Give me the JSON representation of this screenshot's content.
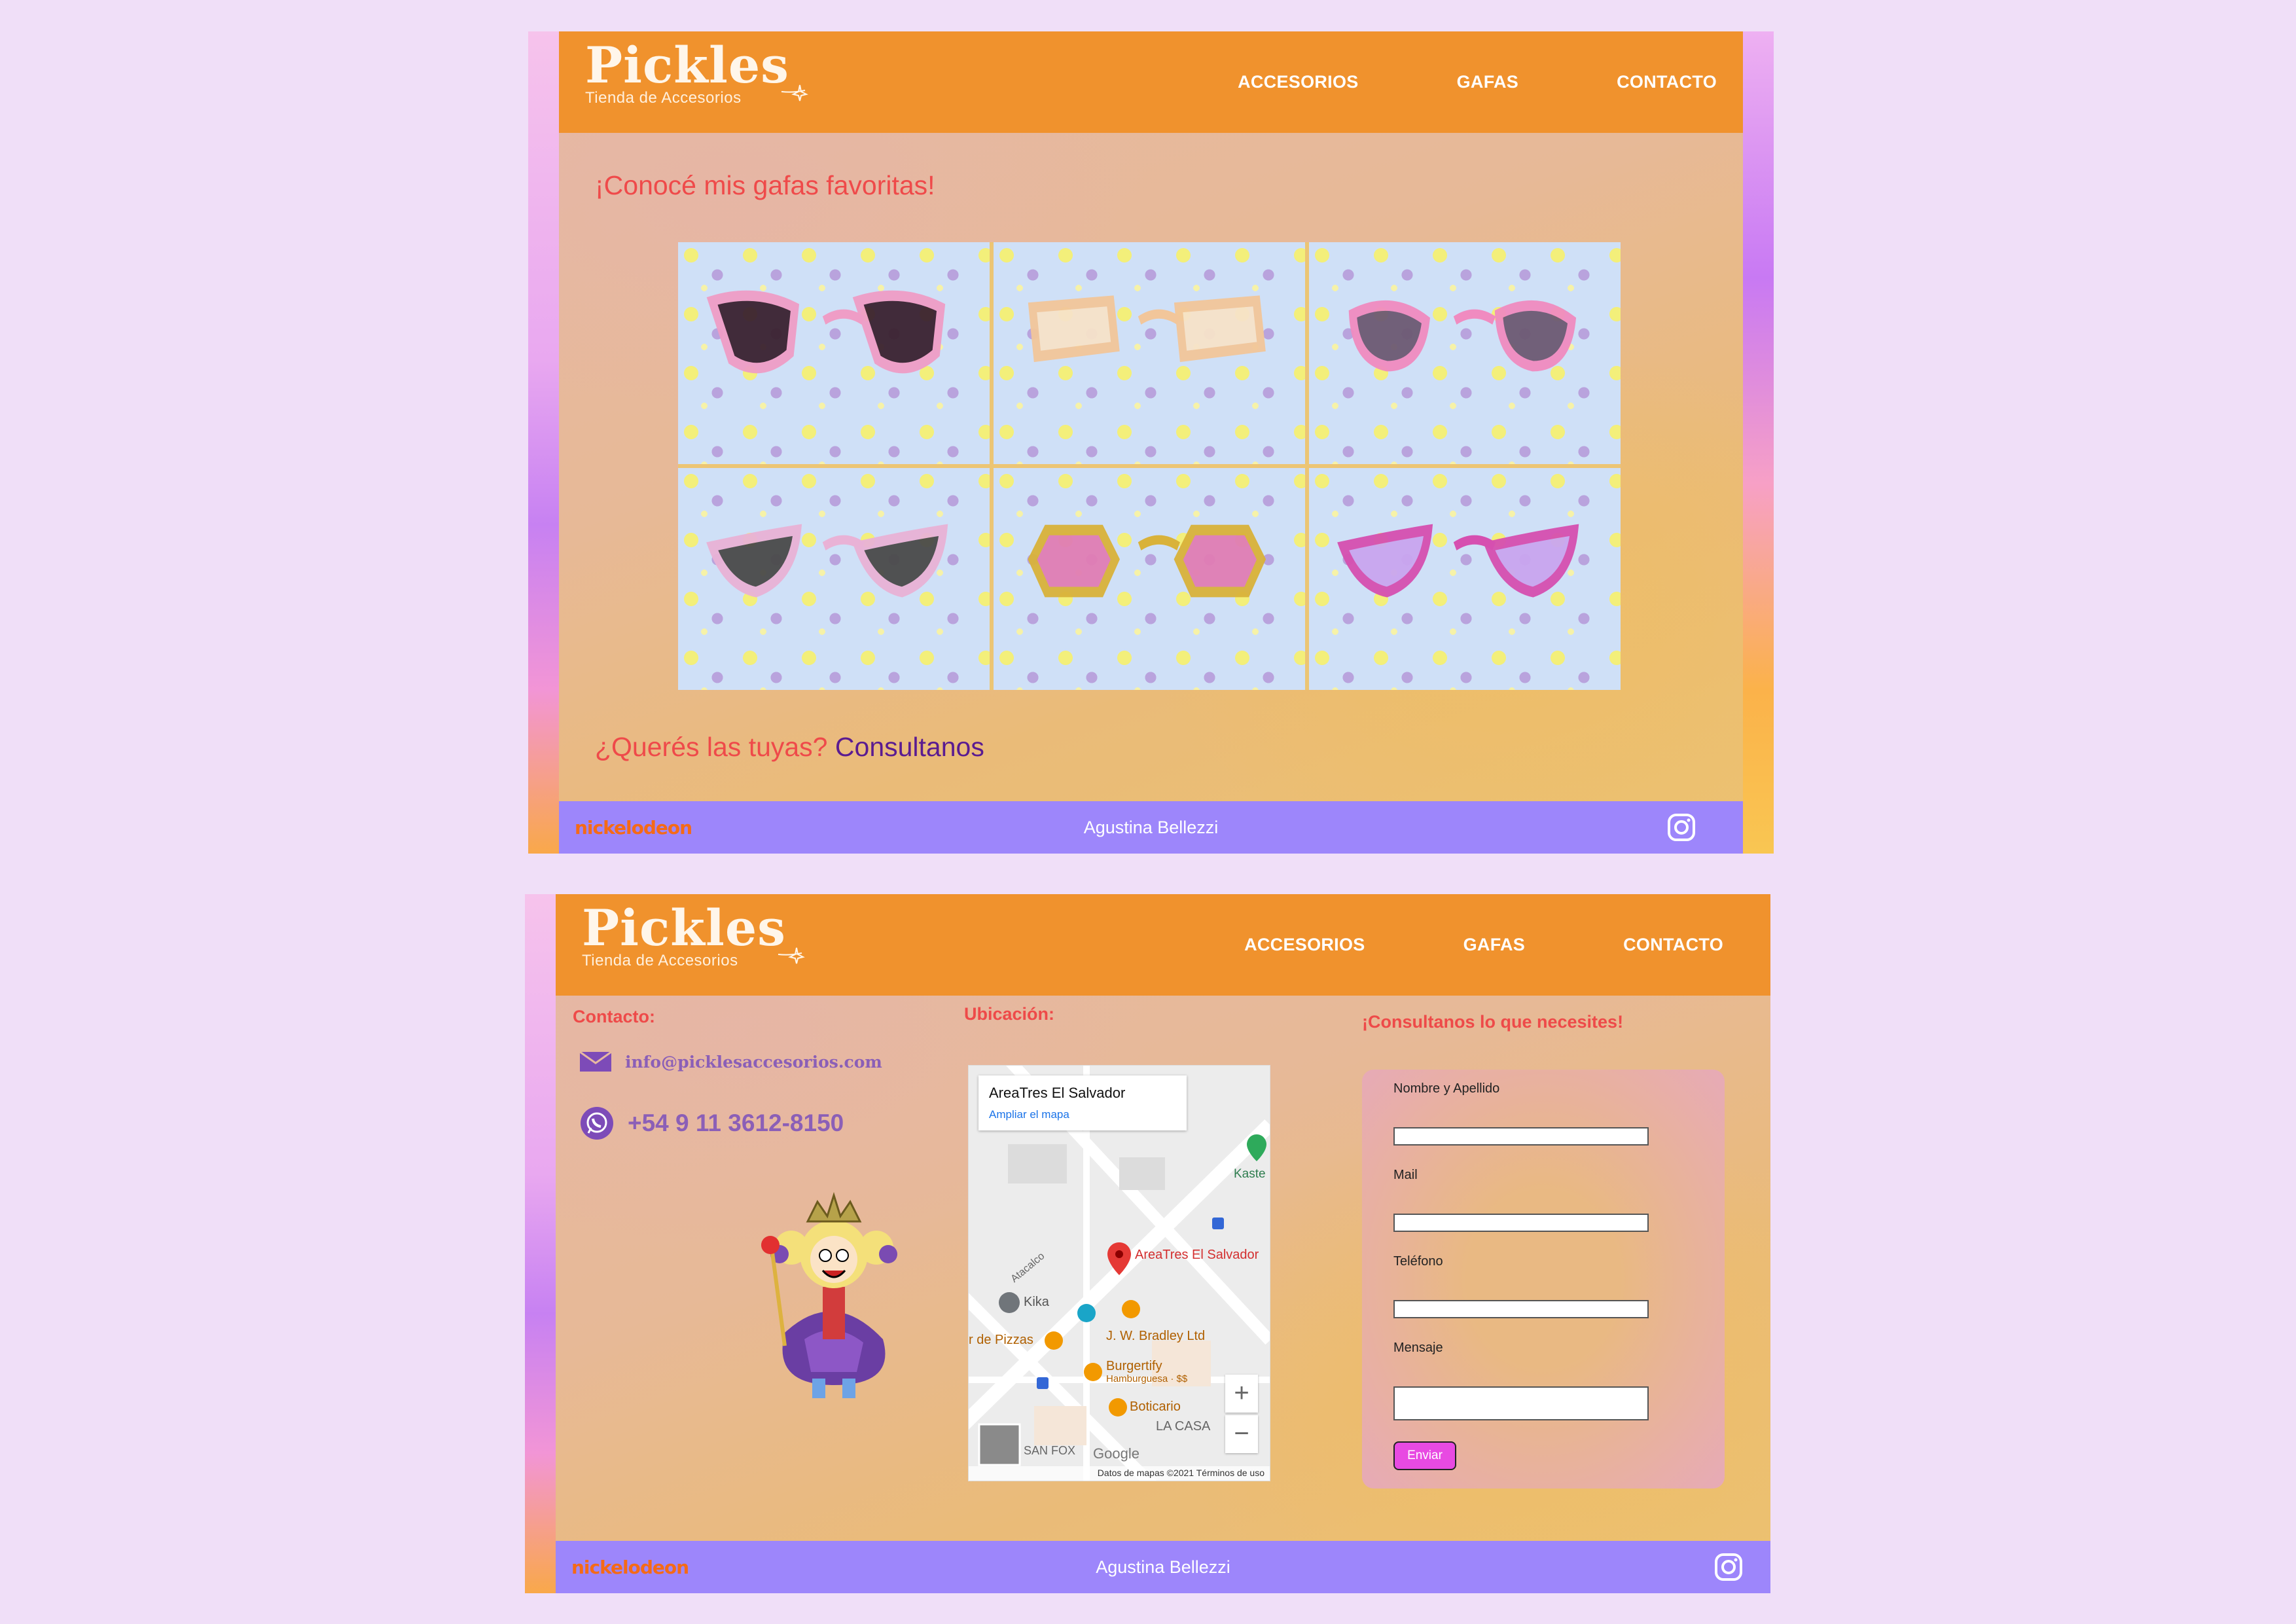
{
  "brand": {
    "name": "Pickles",
    "tagline": "Tienda de Accesorios"
  },
  "nav": [
    "ACCESORIOS",
    "GAFAS",
    "CONTACTO"
  ],
  "gallery": {
    "heading": "¡Conocé mis gafas favoritas!",
    "cta_question": "¿Querés las tuyas?",
    "cta_link": "Consultanos",
    "items": [
      {
        "lens": "#3a2230",
        "frame": "#ef9dc6",
        "shape": "cat"
      },
      {
        "lens": "#f7e3c9",
        "frame": "#f2c69a",
        "shape": "rect"
      },
      {
        "lens": "#6d5a73",
        "frame": "#f08bc0",
        "shape": "oval"
      },
      {
        "lens": "#4a4a4a",
        "frame": "#e9b2d6",
        "shape": "cateye"
      },
      {
        "lens": "#e07db4",
        "frame": "#d9b23a",
        "shape": "hex"
      },
      {
        "lens": "#c9a6ef",
        "frame": "#d64fb0",
        "shape": "cateye"
      }
    ]
  },
  "footer": {
    "logo": "nickelodeon",
    "credit": "Agustina Bellezzi"
  },
  "contact": {
    "title": "Contacto:",
    "email": "info@picklesaccesorios.com",
    "phone": "+54 9 11 3612-8150"
  },
  "location": {
    "title": "Ubicación:",
    "place": "AreaTres El Salvador",
    "enlarge": "Ampliar el mapa",
    "labels": {
      "kaste": "Kaste",
      "areatres": "AreaTres El Salvador",
      "atacalco": "Atacalco",
      "kika": "Kika",
      "pizzas": "r de Pizzas",
      "bradley": "J. W. Bradley Ltd",
      "burgertify": "Burgertify",
      "burger_sub": "Hamburguesa · $$",
      "boticario": "Boticario",
      "lacasa": "LA CASA",
      "sanfox": "SAN FOX",
      "google": "Google"
    },
    "footer": "Datos de mapas ©2021   Términos de uso"
  },
  "form": {
    "title": "¡Consultanos lo que necesites!",
    "name_label": "Nombre y Apellido",
    "mail_label": "Mail",
    "phone_label": "Teléfono",
    "message_label": "Mensaje",
    "submit": "Enviar"
  },
  "colors": {
    "header": "#f0922d",
    "footer": "#9d86fb",
    "accent_red": "#ef4a4a",
    "accent_purple": "#5a1b91"
  }
}
